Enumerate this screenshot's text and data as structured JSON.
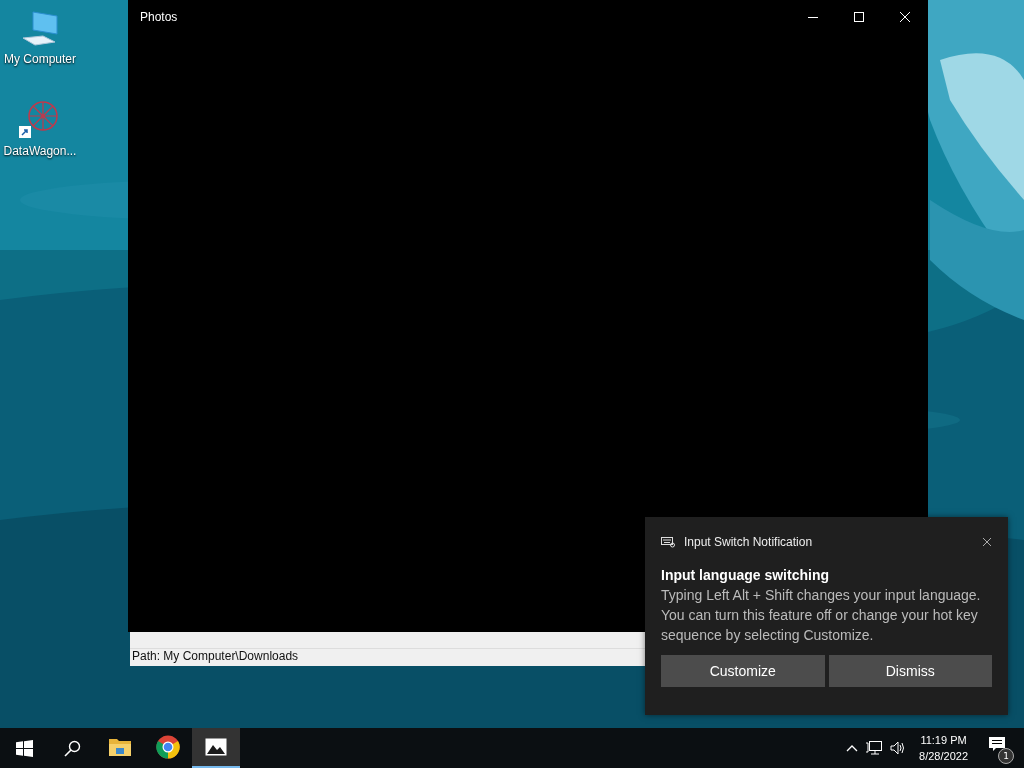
{
  "desktop_icons": [
    {
      "kind": "computer",
      "label": "My Computer"
    },
    {
      "kind": "shortcut",
      "label": "DataWagon..."
    }
  ],
  "explorer_window": {
    "status_bar": "Path: My Computer\\Downloads"
  },
  "photos_window": {
    "title": "Photos"
  },
  "notification": {
    "app": "Input Switch Notification",
    "title": "Input language switching",
    "body": "Typing Left Alt + Shift changes your input language. You can turn this feature off or change your hot key sequence by selecting Customize.",
    "buttons": [
      "Customize",
      "Dismiss"
    ]
  },
  "taskbar": {
    "apps": [
      {
        "kind": "folder",
        "selected": false
      },
      {
        "kind": "browser",
        "selected": false
      },
      {
        "kind": "photos",
        "selected": true
      }
    ],
    "time": "11:19 PM",
    "date": "8/28/2022",
    "notification_count": "1"
  }
}
